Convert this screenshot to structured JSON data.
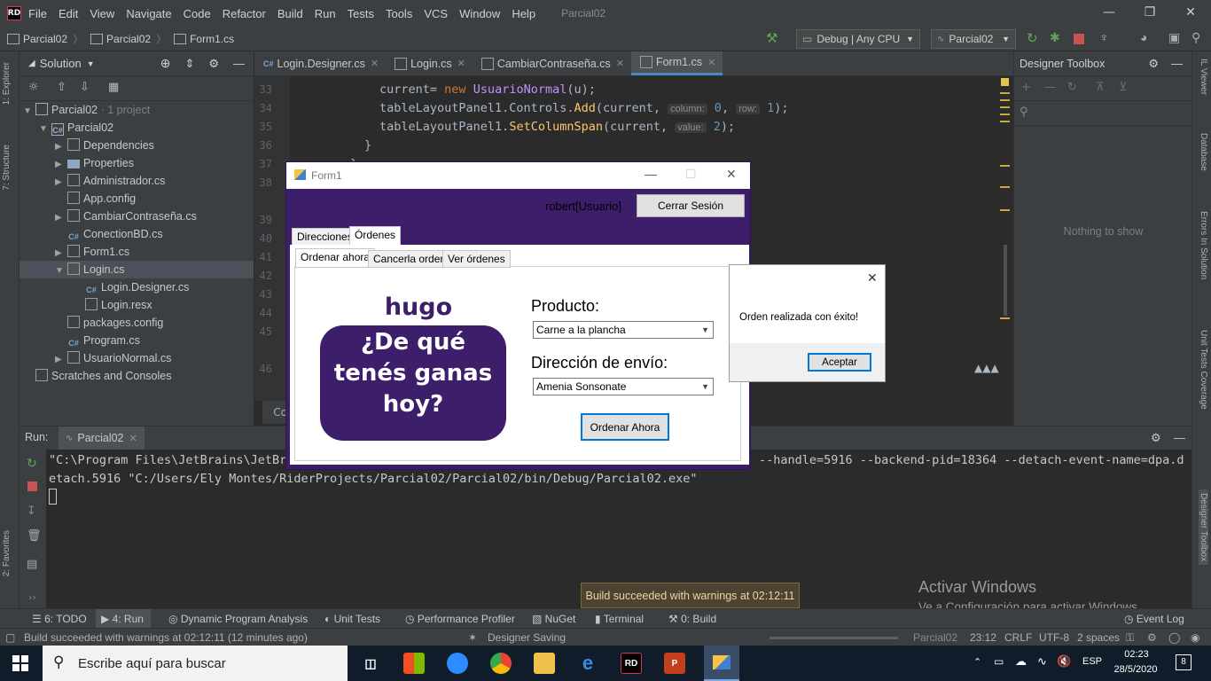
{
  "menubar": {
    "logo": "RD",
    "items": [
      "File",
      "Edit",
      "View",
      "Navigate",
      "Code",
      "Refactor",
      "Build",
      "Run",
      "Tests",
      "Tools",
      "VCS",
      "Window",
      "Help"
    ],
    "project_title": "Parcial02"
  },
  "navbar": {
    "crumbs": [
      "Parcial02",
      "Parcial02",
      "Form1.cs"
    ],
    "run_config": "Debug | Any CPU",
    "project_config": "Parcial02"
  },
  "left_stripe": {
    "explorer": "1: Explorer",
    "structure": "7: Structure",
    "favorites": "2: Favorites"
  },
  "solution": {
    "title": "Solution",
    "items": [
      {
        "label": "Parcial02",
        "sub": " · 1 project"
      },
      {
        "label": "Parcial02"
      },
      {
        "label": "Dependencies"
      },
      {
        "label": "Properties"
      },
      {
        "label": "Administrador.cs"
      },
      {
        "label": "App.config"
      },
      {
        "label": "CambiarContraseña.cs"
      },
      {
        "label": "ConectionBD.cs"
      },
      {
        "label": "Form1.cs"
      },
      {
        "label": "Login.cs"
      },
      {
        "label": "Login.Designer.cs"
      },
      {
        "label": "Login.resx"
      },
      {
        "label": "packages.config"
      },
      {
        "label": "Program.cs"
      },
      {
        "label": "UsuarioNormal.cs"
      },
      {
        "label": "Scratches and Consoles"
      }
    ]
  },
  "editor": {
    "tabs": [
      "Login.Designer.cs",
      "Login.cs",
      "CambiarContraseña.cs",
      "Form1.cs"
    ],
    "line_numbers": [
      "33",
      "34",
      "35",
      "36",
      "37",
      "38",
      "39",
      "40",
      "41",
      "42",
      "43",
      "44",
      "45",
      "46"
    ],
    "code": {
      "l33_a": "current= ",
      "l33_kw": "new",
      "l33_b": " ",
      "l33_ty": "UsuarioNormal",
      "l33_c": "(u);",
      "l34_a": "tableLayoutPanel1.Controls.",
      "l34_m": "Add",
      "l34_b": "(current, ",
      "l34_h1": "column:",
      "l34_n1": "0",
      "l34_c": ", ",
      "l34_h2": "row:",
      "l34_n2": "1",
      "l34_d": ");",
      "l35_a": "tableLayoutPanel1.",
      "l35_m": "SetColumnSpan",
      "l35_b": "(current, ",
      "l35_h": "value:",
      "l35_n": "2",
      "l35_c": ");",
      "l36": "}",
      "l37": "}",
      "co": "Co"
    }
  },
  "toolbox": {
    "title": "Designer Toolbox",
    "empty": "Nothing to show"
  },
  "right_stripe": {
    "il_viewer": "IL Viewer",
    "database": "Database",
    "errors": "Errors In Solution",
    "coverage": "Unit Tests Coverage",
    "designer_toolbox": "Designer Toolbox"
  },
  "run_panel": {
    "label": "Run:",
    "config": "Parcial02",
    "console_line1": "\"C:\\Program Files\\JetBrains\\JetBra",
    "console_line1_end": "--handle=5916 --backend-pid=18364 --detach-event-name=dpa.d",
    "console_line2": "etach.5916 \"C:/Users/Ely Montes/RiderProjects/Parcial02/Parcial02/bin/Debug/Parcial02.exe\""
  },
  "form1": {
    "title": "Form1",
    "user_label": "robert[Usuario]",
    "logout_button": "Cerrar Sesión",
    "outer_tabs": [
      "Direcciones",
      "Órdenes"
    ],
    "inner_tabs": [
      "Ordenar ahora",
      "Cancerla orden",
      "Ver órdenes"
    ],
    "logo_line1": "hugo",
    "logo_line2": "¿De qué",
    "logo_line3": "tenés ganas",
    "logo_line4": "hoy?",
    "product_label": "Producto:",
    "product_value": "Carne a la plancha",
    "address_label": "Dirección de envío:",
    "address_value": "Amenia Sonsonate",
    "order_button": "Ordenar Ahora"
  },
  "msgbox": {
    "message": "Orden realizada con éxito!",
    "accept": "Aceptar"
  },
  "toast": "Build succeeded with warnings at 02:12:11",
  "watermark": {
    "line1": "Activar Windows",
    "line2": "Ve a Configuración para activar Windows."
  },
  "toolstrip": {
    "todo": "6: TODO",
    "run": "4: Run",
    "dpa": "Dynamic Program Analysis",
    "unit_tests": "Unit Tests",
    "profiler": "Performance Profiler",
    "nuget": "NuGet",
    "terminal": "Terminal",
    "build": "0: Build",
    "event_log": "Event Log"
  },
  "statusbar": {
    "message": "Build succeeded with warnings at 02:12:11 (12 minutes ago)",
    "designer_saving": "Designer Saving",
    "project": "Parcial02",
    "position": "23:12",
    "line_ending": "CRLF",
    "encoding": "UTF-8",
    "indent": "2 spaces"
  },
  "taskbar": {
    "search_placeholder": "Escribe aquí para buscar",
    "language": "ESP",
    "time": "02:23",
    "date": "28/5/2020",
    "notifications": "8"
  },
  "colors": {
    "ide_bg": "#2b2b2b",
    "panel_bg": "#3c3f41",
    "form_purple": "#3d1e6b",
    "taskbar": "#101c2a"
  }
}
